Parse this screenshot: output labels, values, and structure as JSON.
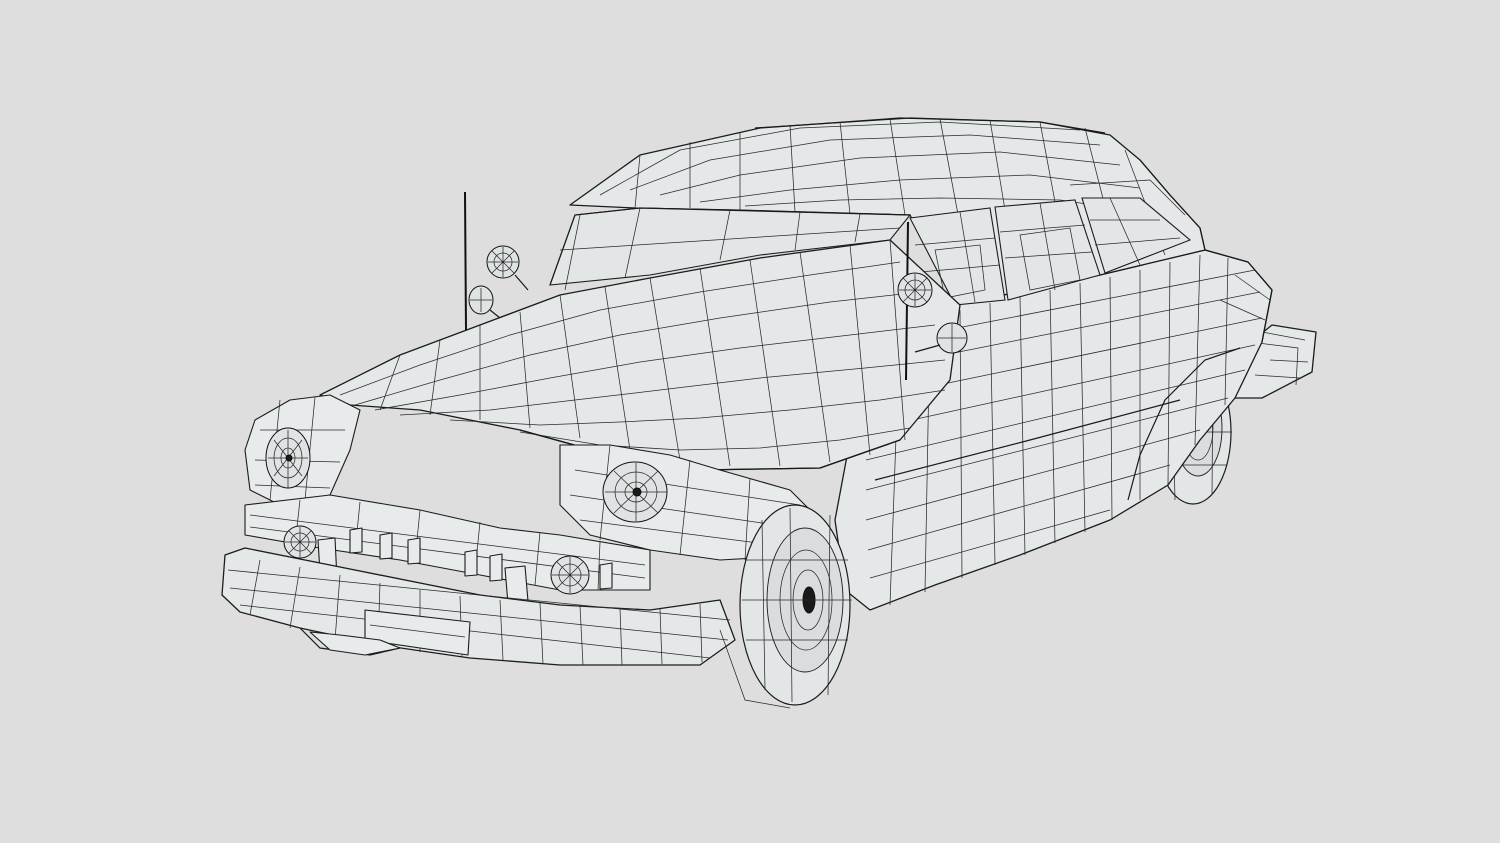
{
  "scene": {
    "subject": "car-wireframe",
    "colors": {
      "background": "#dedede",
      "surface": "#e4e8e8",
      "wire": "#1c1c1c"
    }
  }
}
